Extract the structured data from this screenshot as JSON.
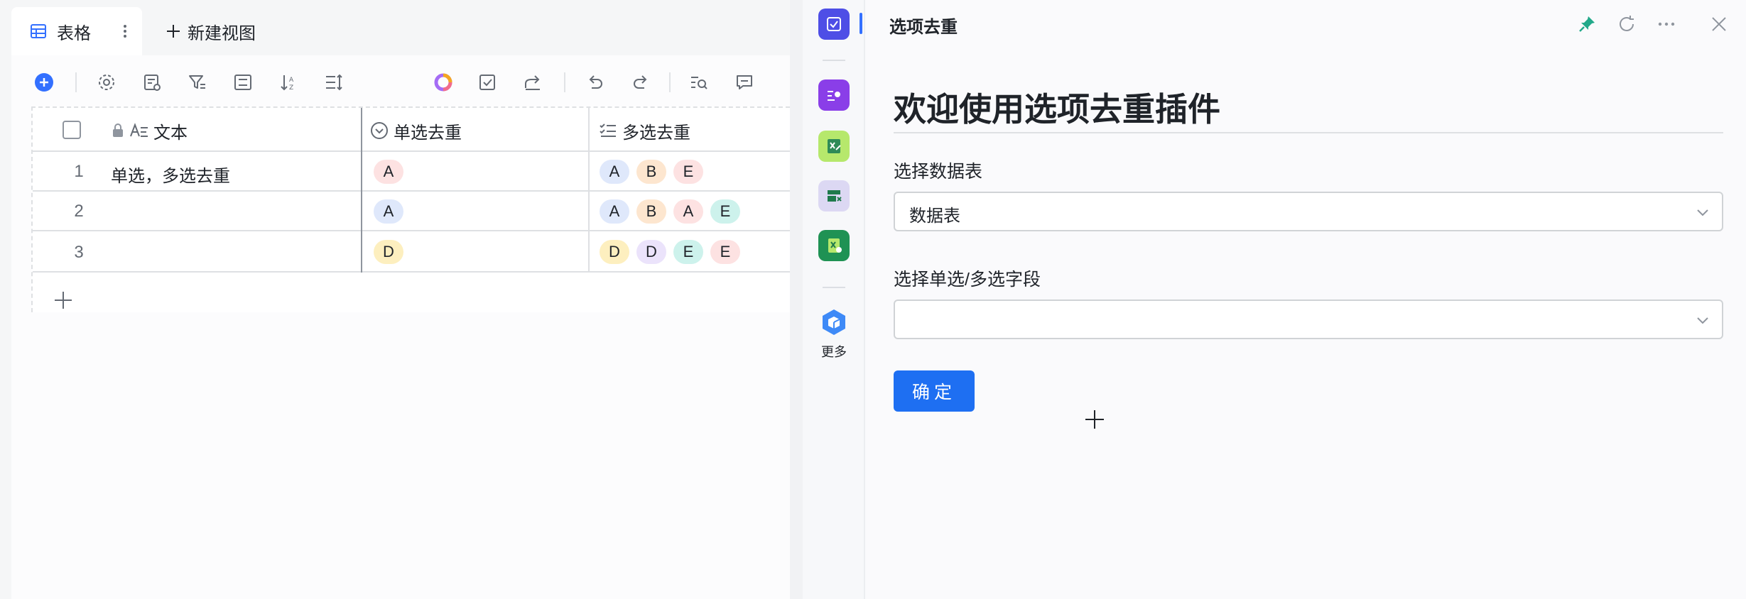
{
  "view": {
    "tab_label": "表格",
    "new_view_label": "新建视图"
  },
  "table": {
    "columns": [
      {
        "name": "文本",
        "icon": "text-field-icon"
      },
      {
        "name": "单选去重",
        "icon": "single-select-icon"
      },
      {
        "name": "多选去重",
        "icon": "multi-select-icon"
      }
    ],
    "rows": [
      {
        "num": "1",
        "text": "单选，多选去重",
        "single": "A",
        "multi": [
          "A",
          "B",
          "E"
        ]
      },
      {
        "num": "2",
        "text": "",
        "single": "A",
        "multi": [
          "A",
          "B",
          "A",
          "E"
        ]
      },
      {
        "num": "3",
        "text": "",
        "single": "D",
        "multi": [
          "D",
          "D",
          "E",
          "E"
        ]
      }
    ]
  },
  "option_colors": {
    "A_multi": "#dfe8fb",
    "A_single": "#fde2e2",
    "B": "#fde6cf",
    "E": "#fde2e2",
    "E_teal": "#cdf2ec",
    "D": "#fdefbf",
    "D_purple": "#ebe3fb"
  },
  "rail": {
    "more_label": "更多",
    "accent": "#3370ff"
  },
  "panel": {
    "title": "选项去重",
    "welcome": "欢迎使用选项去重插件",
    "table_label": "选择数据表",
    "table_value": "数据表",
    "field_label": "选择单选/多选字段",
    "field_value": "",
    "confirm_label": "确定",
    "brand_color": "#1e6ff2"
  }
}
